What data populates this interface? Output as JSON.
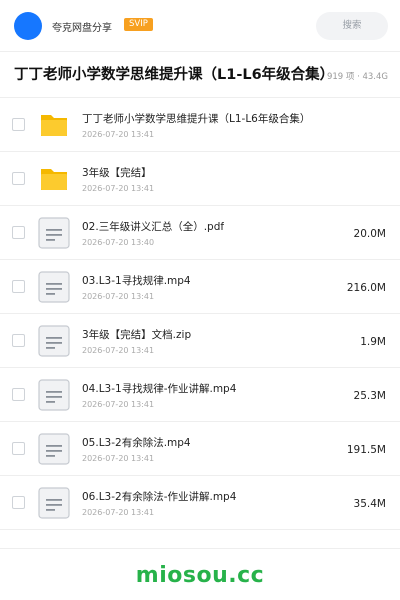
{
  "header": {
    "user_name": "夸克网盘分享",
    "badge": "SVIP",
    "search_placeholder": "搜索"
  },
  "folder": {
    "title": "丁丁老师小学数学思维提升课（L1-L6年级合集）",
    "meta": "919 项 · 43.4G"
  },
  "files": [
    {
      "name": "丁丁老师小学数学思维提升课（L1-L6年级合集）",
      "date": "2026-07-20 13:41",
      "size": "",
      "type": "folder",
      "icon": "folder-icon"
    },
    {
      "name": "3年级【完结】",
      "date": "2026-07-20 13:41",
      "size": "",
      "type": "folder",
      "icon": "folder-icon"
    },
    {
      "name": "02.三年级讲义汇总（全）.pdf",
      "date": "2026-07-20 13:40",
      "size": "20.0M",
      "type": "file",
      "icon": "document-icon"
    },
    {
      "name": "03.L3-1寻找规律.mp4",
      "date": "2026-07-20 13:41",
      "size": "216.0M",
      "type": "file",
      "icon": "document-icon"
    },
    {
      "name": "3年级【完结】文档.zip",
      "date": "2026-07-20 13:41",
      "size": "1.9M",
      "type": "file",
      "icon": "document-icon"
    },
    {
      "name": "04.L3-1寻找规律-作业讲解.mp4",
      "date": "2026-07-20 13:41",
      "size": "25.3M",
      "type": "file",
      "icon": "document-icon"
    },
    {
      "name": "05.L3-2有余除法.mp4",
      "date": "2026-07-20 13:41",
      "size": "191.5M",
      "type": "file",
      "icon": "document-icon"
    },
    {
      "name": "06.L3-2有余除法-作业讲解.mp4",
      "date": "2026-07-20 13:41",
      "size": "35.4M",
      "type": "file",
      "icon": "document-icon"
    }
  ],
  "footer": {
    "brand": "miosou.cc"
  },
  "colors": {
    "accent_blue": "#1677ff",
    "svip_orange": "#f7a020",
    "folder_yellow": "#fccb2e",
    "brand_green": "#27b24a"
  }
}
